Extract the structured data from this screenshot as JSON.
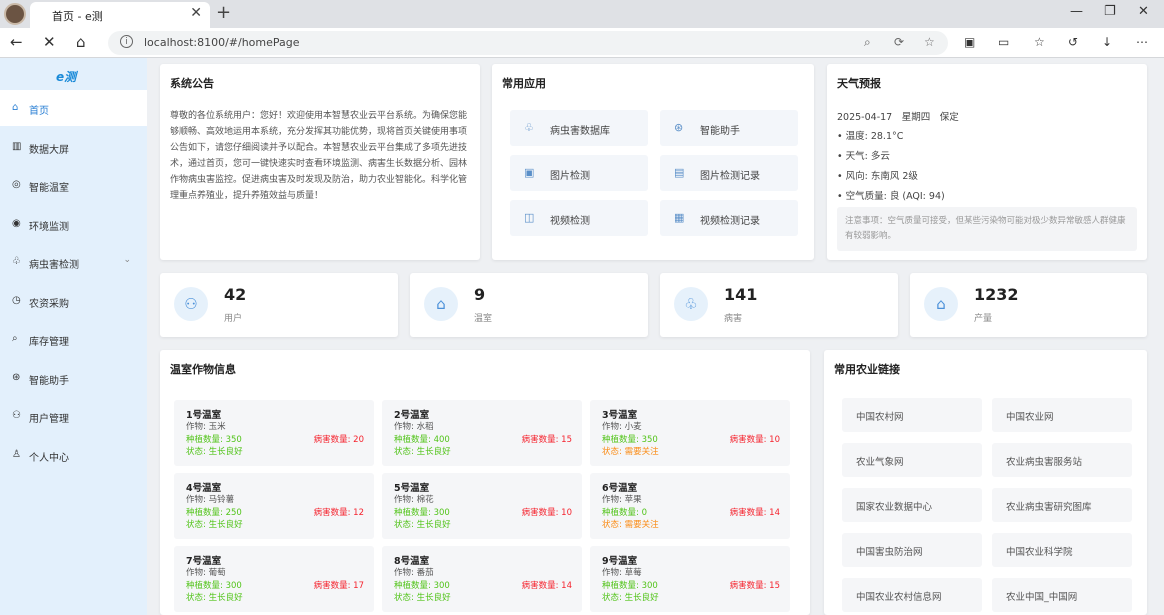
{
  "browser": {
    "tab_title": "首页 - e测",
    "tab_close": "✕",
    "new_tab": "+",
    "url": "localhost:8100/#/homePage",
    "win_min": "—",
    "win_max": "❐",
    "win_close": "✕"
  },
  "sidebar": {
    "logo": "e测",
    "items": [
      {
        "label": "首页",
        "icon": "home-icon",
        "glyph": "⌂"
      },
      {
        "label": "数据大屏",
        "icon": "chart-icon",
        "glyph": "▥"
      },
      {
        "label": "智能温室",
        "icon": "greenhouse-icon",
        "glyph": "◎"
      },
      {
        "label": "环境监测",
        "icon": "monitor-icon",
        "glyph": "◉"
      },
      {
        "label": "病虫害检测",
        "icon": "bug-icon",
        "glyph": "♧",
        "arrow": "⌄"
      },
      {
        "label": "农资采购",
        "icon": "cart-icon",
        "glyph": "◷"
      },
      {
        "label": "库存管理",
        "icon": "inventory-icon",
        "glyph": "⌕"
      },
      {
        "label": "智能助手",
        "icon": "robot-icon",
        "glyph": "⊛"
      },
      {
        "label": "用户管理",
        "icon": "users-icon",
        "glyph": "⚇"
      },
      {
        "label": "个人中心",
        "icon": "user-icon",
        "glyph": "♙"
      }
    ]
  },
  "notice": {
    "title": "系统公告",
    "body": "尊敬的各位系统用户：您好！欢迎使用本智慧农业云平台系统。为确保您能够顺畅、高效地运用本系统，充分发挥其功能优势，现将首页关键使用事项公告如下，请您仔细阅读并予以配合。本智慧农业云平台集成了多项先进技术，通过首页，您可一键快速实时查看环境监测、病害生长数据分析、园林作物病虫害监控。促进病虫害及时发现及防治，助力农业智能化。科学化管理重点养殖业，提升养殖效益与质量！"
  },
  "apps": {
    "title": "常用应用",
    "items": [
      {
        "label": "病虫害数据库",
        "glyph": "♧"
      },
      {
        "label": "智能助手",
        "glyph": "⊛"
      },
      {
        "label": "图片检测",
        "glyph": "▣"
      },
      {
        "label": "图片检测记录",
        "glyph": "▤"
      },
      {
        "label": "视频检测",
        "glyph": "◫"
      },
      {
        "label": "视频检测记录",
        "glyph": "▦"
      }
    ]
  },
  "weather": {
    "title": "天气预报",
    "date": "2025-04-17　星期四　保定",
    "lines": [
      "• 温度: 28.1°C",
      "• 天气: 多云",
      "• 风向: 东南风 2级",
      "• 空气质量: 良 (AQI: 94)"
    ],
    "tip": "注意事项：空气质量可接受，但某些污染物可能对极少数异常敏感人群健康有较弱影响。"
  },
  "stats": [
    {
      "value": "42",
      "label": "用户",
      "glyph": "⚇"
    },
    {
      "value": "9",
      "label": "温室",
      "glyph": "⌂"
    },
    {
      "value": "141",
      "label": "病害",
      "glyph": "♧"
    },
    {
      "value": "1232",
      "label": "产量",
      "glyph": "⌂"
    }
  ],
  "greenhouses": {
    "title": "温室作物信息",
    "items": [
      {
        "name": "1号温室",
        "crop": "作物: 玉米",
        "plant": "种植数量: 350",
        "pest": "病害数量: 20",
        "status": "状态: 生长良好",
        "warn": false
      },
      {
        "name": "2号温室",
        "crop": "作物: 水稻",
        "plant": "种植数量: 400",
        "pest": "病害数量: 15",
        "status": "状态: 生长良好",
        "warn": false
      },
      {
        "name": "3号温室",
        "crop": "作物: 小麦",
        "plant": "种植数量: 350",
        "pest": "病害数量: 10",
        "status": "状态: 需要关注",
        "warn": true
      },
      {
        "name": "4号温室",
        "crop": "作物: 马铃薯",
        "plant": "种植数量: 250",
        "pest": "病害数量: 12",
        "status": "状态: 生长良好",
        "warn": false
      },
      {
        "name": "5号温室",
        "crop": "作物: 棉花",
        "plant": "种植数量: 300",
        "pest": "病害数量: 10",
        "status": "状态: 生长良好",
        "warn": false
      },
      {
        "name": "6号温室",
        "crop": "作物: 苹果",
        "plant": "种植数量: 0",
        "pest": "病害数量: 14",
        "status": "状态: 需要关注",
        "warn": true
      },
      {
        "name": "7号温室",
        "crop": "作物: 葡萄",
        "plant": "种植数量: 300",
        "pest": "病害数量: 17",
        "status": "状态: 生长良好",
        "warn": false
      },
      {
        "name": "8号温室",
        "crop": "作物: 番茄",
        "plant": "种植数量: 300",
        "pest": "病害数量: 14",
        "status": "状态: 生长良好",
        "warn": false
      },
      {
        "name": "9号温室",
        "crop": "作物: 草莓",
        "plant": "种植数量: 300",
        "pest": "病害数量: 15",
        "status": "状态: 生长良好",
        "warn": false
      }
    ]
  },
  "links": {
    "title": "常用农业链接",
    "items": [
      "中国农村网",
      "中国农业网",
      "农业气象网",
      "农业病虫害服务站",
      "国家农业数据中心",
      "农业病虫害研究图库",
      "中国害虫防治网",
      "中国农业科学院",
      "中国农业农村信息网",
      "农业中国_中国网"
    ]
  },
  "colors": {
    "accent": "#2a7fd4",
    "sidebar_bg": "#e3f0fc",
    "ok": "#52c41a",
    "warn": "#fa8c16",
    "danger": "#f5222d"
  }
}
